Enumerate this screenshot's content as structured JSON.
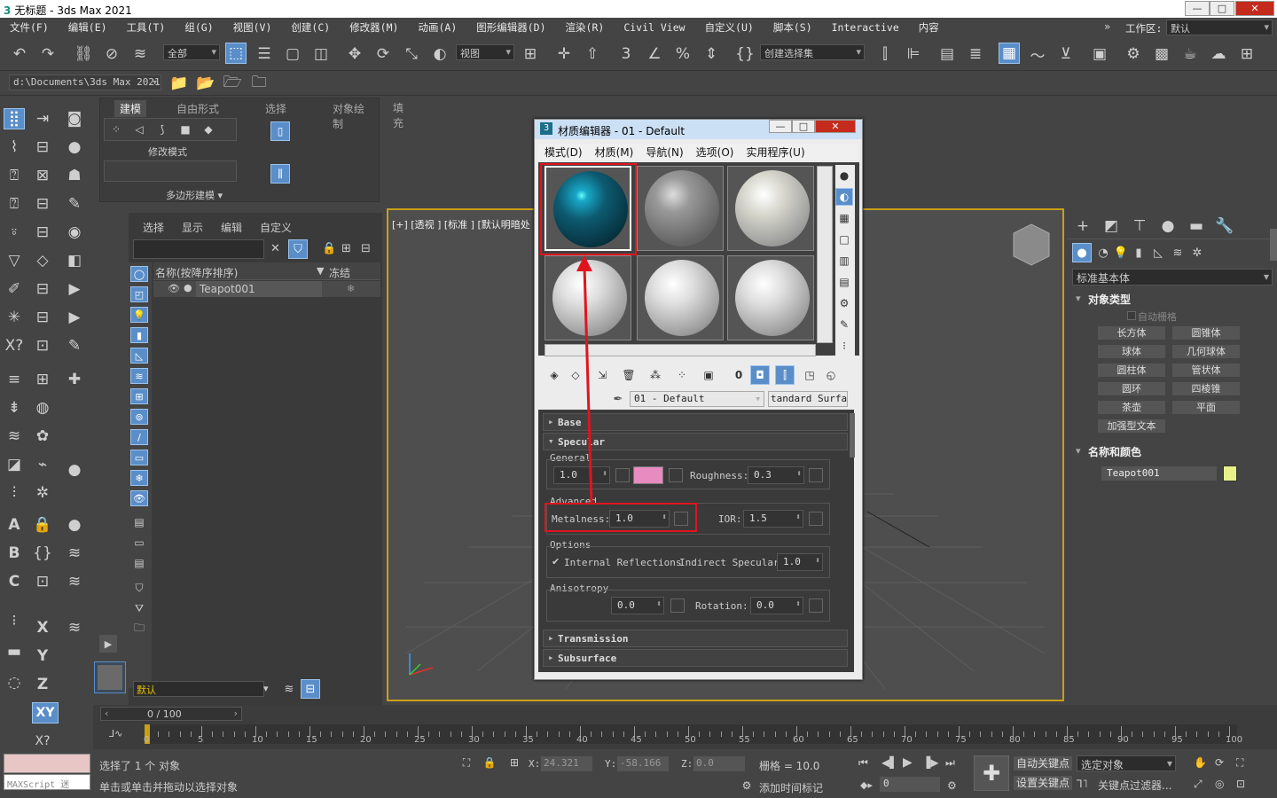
{
  "window": {
    "title": "无标题 - 3ds Max 2021",
    "min": "—",
    "max": "□",
    "close": "✕"
  },
  "menu": [
    "文件(F)",
    "编辑(E)",
    "工具(T)",
    "组(G)",
    "视图(V)",
    "创建(C)",
    "修改器(M)",
    "动画(A)",
    "图形编辑器(D)",
    "渲染(R)",
    "Civil View",
    "自定义(U)",
    "脚本(S)",
    "Interactive",
    "内容"
  ],
  "workspace": {
    "label": "工作区:",
    "value": "默认"
  },
  "toolbar": {
    "selection_filter": "全部",
    "ref_coord": "视图",
    "named_selection": "创建选择集"
  },
  "project": {
    "path": "d:\\Documents\\3ds Max 2021"
  },
  "ribbon": {
    "tabs": [
      "建模",
      "自由形式",
      "选择",
      "对象绘制",
      "填充"
    ],
    "modify_mode": "修改模式",
    "poly_modeling": "多边形建模 ▾"
  },
  "scene_explorer": {
    "menu": [
      "选择",
      "显示",
      "编辑",
      "自定义"
    ],
    "col_name": "名称(按降序排序)",
    "col_freeze": "冻结",
    "item": "Teapot001",
    "freeze_icon": "❄",
    "layer": "默认"
  },
  "viewport": {
    "label": "[+] [透视 ] [标准 ] [默认明暗处"
  },
  "material_editor": {
    "title": "材质编辑器 - 01 - Default",
    "menu": [
      "模式(D)",
      "材质(M)",
      "导航(N)",
      "选项(O)",
      "实用程序(U)"
    ],
    "mat_name": "01 - Default",
    "mat_type": "tandard Surfac",
    "rollouts": {
      "base": "Base",
      "specular": "Specular",
      "transmission": "Transmission",
      "subsurface": "Subsurface"
    },
    "specular": {
      "general": "General",
      "weight": "1.0",
      "color": "#e88bc0",
      "roughness_label": "Roughness:",
      "roughness": "0.3",
      "advanced": "Advanced",
      "metalness_label": "Metalness:",
      "metalness": "1.0",
      "ior_label": "IOR:",
      "ior": "1.5",
      "options": "Options",
      "internal_refl": "Internal Reflections",
      "indirect_label": "Indirect Specular:",
      "indirect": "1.0",
      "anisotropy_label": "Anisotropy",
      "anisotropy": "0.0",
      "rotation_label": "Rotation:",
      "rotation": "0.0"
    }
  },
  "command_panel": {
    "category": "标准基本体",
    "object_type": "对象类型",
    "autogrid": "自动栅格",
    "buttons": [
      "长方体",
      "圆锥体",
      "球体",
      "几何球体",
      "圆柱体",
      "管状体",
      "圆环",
      "四棱锥",
      "茶壶",
      "平面",
      "加强型文本"
    ],
    "name_color": "名称和颜色",
    "object_name": "Teapot001",
    "object_color": "#e8f08a"
  },
  "timeline": {
    "frame": "0 / 100",
    "ticks": [
      "0",
      "5",
      "10",
      "15",
      "20",
      "25",
      "30",
      "35",
      "40",
      "45",
      "50",
      "55",
      "60",
      "65",
      "70",
      "75",
      "80",
      "85",
      "90",
      "95",
      "100"
    ]
  },
  "status": {
    "maxscript": "MAXScript 迷",
    "selected": "选择了 1 个 对象",
    "hint": "单击或单击并拖动以选择对象",
    "x_label": "X:",
    "x": "24.321",
    "y_label": "Y:",
    "y": "-58.166",
    "z_label": "Z:",
    "z": "0.0",
    "grid": "栅格 = 10.0",
    "add_time_tag": "添加时间标记",
    "auto_key": "自动关键点",
    "selected_obj": "选定对象",
    "set_key": "设置关键点",
    "key_filter": "关键点过滤器...",
    "frame_spin": "0"
  }
}
